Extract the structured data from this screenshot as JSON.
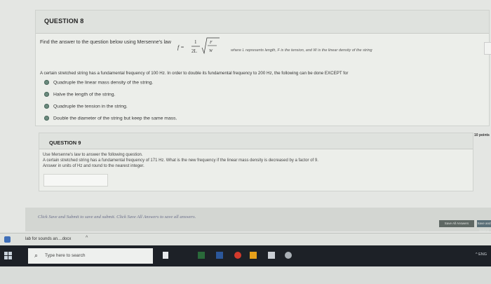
{
  "question8": {
    "title": "QUESTION 8",
    "prompt": "Find the answer to the question below using Mersenne's law",
    "formula_prefix": "f =",
    "formula_num": "1",
    "formula_den": "2L",
    "formula_F": "F",
    "formula_W": "W",
    "formula_tail": "where L represents length, F is the tension, and W is the linear density of the string",
    "scenario": "A certain stretched string has a fundamental frequency of 100 Hz. In order to double its fundamental frequency to 200 Hz, the following can be done EXCEPT for",
    "options": [
      "Quadruple the linear mass density of the string.",
      "Halve the length of the string.",
      "Quadruple the tension in the string.",
      "Double the diameter of the string but keep the same mass."
    ]
  },
  "question9": {
    "title": "QUESTION 9",
    "points": "10 points",
    "line1": "Use Mersenne's law to answer the following question.",
    "line2": "A certain stretched string has a fundamental frequency of 171 Hz. What is the new frequency if the linear mass density is decreased by a factor of 9.",
    "line3": "Answer in units of Hz and round to the nearest integer."
  },
  "footer": {
    "instruction": "Click Save and Submit to save and submit. Click Save All Answers to save all answers.",
    "save_all": "Save All Answers",
    "submit": "Save and Submit"
  },
  "download_bar": {
    "filename": "lab for sounds an....docx",
    "chevron": "^"
  },
  "taskbar": {
    "search_placeholder": "Type here to search",
    "tray_text": "^ ENG"
  },
  "colors": {
    "taskbar": "#1d2127",
    "radio": "#6b8a7e",
    "footer_text": "#6a6e8a"
  }
}
